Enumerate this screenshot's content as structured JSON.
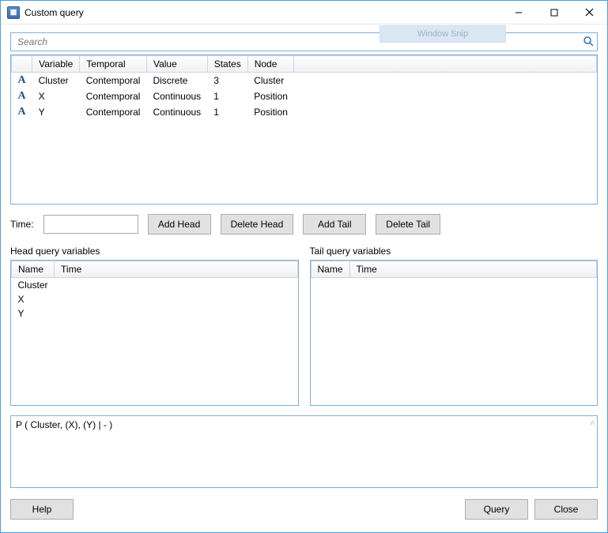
{
  "window": {
    "title": "Custom query",
    "snip_ghost": "Window Snip"
  },
  "search": {
    "placeholder": "Search"
  },
  "vartable": {
    "columns": [
      "",
      "Variable",
      "Temporal",
      "Value",
      "States",
      "Node"
    ],
    "rows": [
      {
        "icon": "A",
        "variable": "Cluster",
        "temporal": "Contemporal",
        "value": "Discrete",
        "states": "3",
        "node": "Cluster"
      },
      {
        "icon": "A",
        "variable": "X",
        "temporal": "Contemporal",
        "value": "Continuous",
        "states": "1",
        "node": "Position"
      },
      {
        "icon": "A",
        "variable": "Y",
        "temporal": "Contemporal",
        "value": "Continuous",
        "states": "1",
        "node": "Position"
      }
    ]
  },
  "time": {
    "label": "Time:",
    "value": ""
  },
  "buttons": {
    "add_head": "Add Head",
    "delete_head": "Delete Head",
    "add_tail": "Add Tail",
    "delete_tail": "Delete Tail",
    "help": "Help",
    "query": "Query",
    "close": "Close"
  },
  "headpanel": {
    "title": "Head query variables",
    "columns": [
      "Name",
      "Time"
    ],
    "rows": [
      {
        "name": "Cluster",
        "time": ""
      },
      {
        "name": "X",
        "time": ""
      },
      {
        "name": "Y",
        "time": ""
      }
    ]
  },
  "tailpanel": {
    "title": "Tail query variables",
    "columns": [
      "Name",
      "Time"
    ],
    "rows": []
  },
  "expression": "P ( Cluster, (X), (Y) | -  )"
}
